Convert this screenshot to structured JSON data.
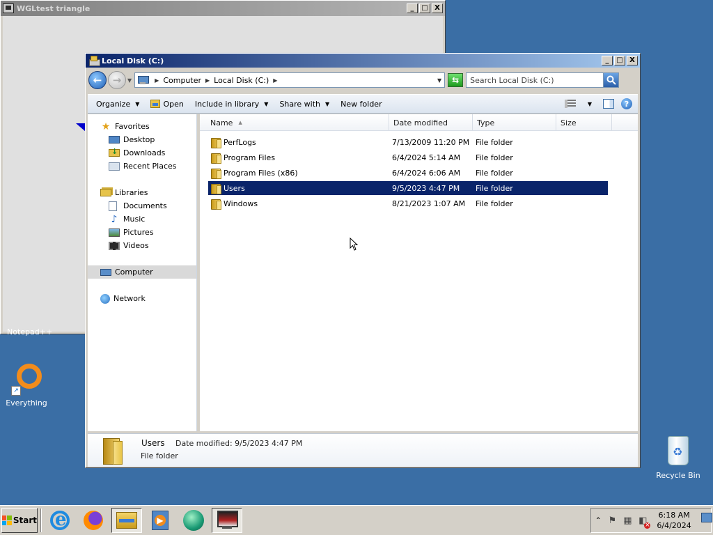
{
  "bg_window": {
    "title": "WGLtest triangle",
    "btn_min": "_",
    "btn_max": "□",
    "btn_close": "X"
  },
  "desktop": {
    "partial_label": "Notepad++",
    "everything_label": "Everything",
    "recycle_label": "Recycle Bin"
  },
  "explorer": {
    "title": "Local Disk (C:)",
    "btn_min": "_",
    "btn_max": "□",
    "btn_close": "X",
    "address": {
      "crumbs": [
        "Computer",
        "Local Disk (C:)"
      ],
      "search_placeholder": "Search Local Disk (C:)"
    },
    "toolbar": {
      "organize": "Organize",
      "open": "Open",
      "include": "Include in library",
      "share": "Share with",
      "new_folder": "New folder"
    },
    "nav": {
      "favorites": "Favorites",
      "desktop": "Desktop",
      "downloads": "Downloads",
      "recent": "Recent Places",
      "libraries": "Libraries",
      "documents": "Documents",
      "music": "Music",
      "pictures": "Pictures",
      "videos": "Videos",
      "computer": "Computer",
      "network": "Network"
    },
    "columns": {
      "name": "Name",
      "date": "Date modified",
      "type": "Type",
      "size": "Size"
    },
    "files": [
      {
        "name": "PerfLogs",
        "date": "7/13/2009 11:20 PM",
        "type": "File folder"
      },
      {
        "name": "Program Files",
        "date": "6/4/2024 5:14 AM",
        "type": "File folder"
      },
      {
        "name": "Program Files (x86)",
        "date": "6/4/2024 6:06 AM",
        "type": "File folder"
      },
      {
        "name": "Users",
        "date": "9/5/2023 4:47 PM",
        "type": "File folder",
        "selected": true
      },
      {
        "name": "Windows",
        "date": "8/21/2023 1:07 AM",
        "type": "File folder"
      }
    ],
    "details": {
      "name": "Users",
      "date_modified": "Date modified: 9/5/2023 4:47 PM",
      "type": "File folder"
    }
  },
  "taskbar": {
    "start_label": "Start",
    "clock_time": "6:18 AM",
    "clock_date": "6/4/2024"
  },
  "icons": {
    "back": "back-arrow-icon",
    "forward": "forward-arrow-icon",
    "refresh": "refresh-icon",
    "search": "magnifier-icon"
  },
  "colors": {
    "desktop": "#3a6ea5",
    "title_active": "#0a246a",
    "selection": "#0a246a"
  }
}
